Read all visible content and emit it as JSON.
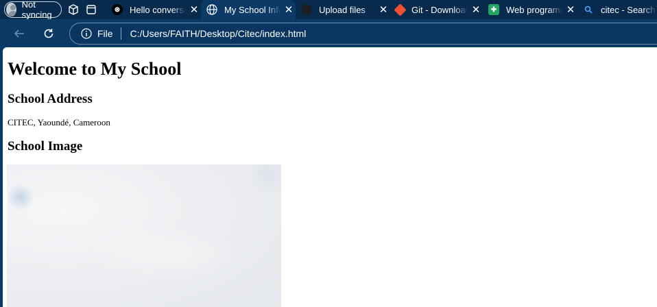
{
  "profile": {
    "label": "Not syncing"
  },
  "tabs": [
    {
      "title": "Hello conversation",
      "favicon": "openai-icon",
      "active": false
    },
    {
      "title": "My School Info",
      "favicon": "globe-icon",
      "active": true
    },
    {
      "title": "Upload files",
      "favicon": "github-icon",
      "active": false
    },
    {
      "title": "Git - Downloads",
      "favicon": "git-icon",
      "active": false
    },
    {
      "title": "Web programming",
      "favicon": "sheets-icon",
      "active": false
    },
    {
      "title": "citec - Search",
      "favicon": "search-icon",
      "active": false
    }
  ],
  "address_bar": {
    "scheme_label": "File",
    "url": "C:/Users/FAITH/Desktop/Citec/index.html"
  },
  "page": {
    "heading": "Welcome to My School",
    "address_heading": "School Address",
    "address_text": "CITEC, Yaoundé, Cameroon",
    "image_heading": "School Image"
  },
  "colors": {
    "tabstrip": "#082b4d",
    "toolbar": "#0b3a66",
    "page_bg": "#ffffff"
  }
}
